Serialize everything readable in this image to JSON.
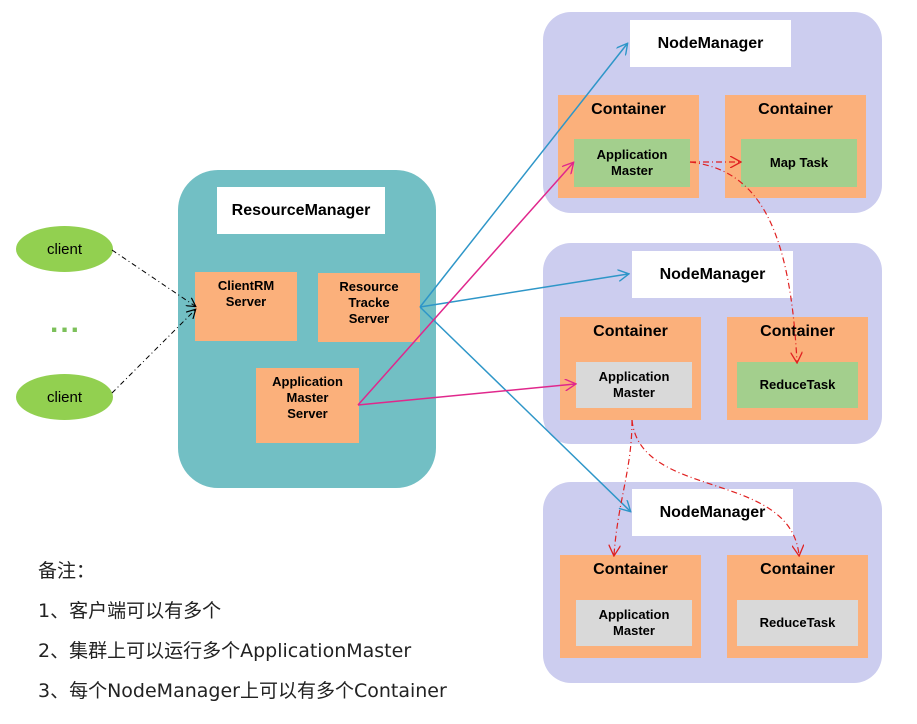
{
  "resource_manager": {
    "title": "ResourceManager",
    "client_rm_server": "ClientRM\nServer",
    "resource_tracker_server": "Resource\nTracke\nServer",
    "app_master_server": "Application\nMaster\nServer"
  },
  "clients": [
    {
      "label": "client"
    },
    {
      "label": "client"
    }
  ],
  "ellipsis": "...",
  "node_managers": [
    {
      "title": "NodeManager",
      "containers": [
        {
          "label": "Container",
          "inner": "Application\nMaster"
        },
        {
          "label": "Container",
          "inner": "Map Task"
        }
      ]
    },
    {
      "title": "NodeManager",
      "containers": [
        {
          "label": "Container",
          "inner": "Application\nMaster"
        },
        {
          "label": "Container",
          "inner": "ReduceTask"
        }
      ]
    },
    {
      "title": "NodeManager",
      "containers": [
        {
          "label": "Container",
          "inner": "Application\nMaster"
        },
        {
          "label": "Container",
          "inner": "ReduceTask"
        }
      ]
    }
  ],
  "notes": {
    "heading": "备注：",
    "items": [
      "1、客户端可以有多个",
      "2、集群上可以运行多个ApplicationMaster",
      "3、每个NodeManager上可以有多个Container"
    ]
  },
  "colors": {
    "node_group": "#cccdef",
    "resource_manager": "#72bfc4",
    "container": "#fbb07b",
    "task_green": "#a3cf8d",
    "task_gray": "#d9d9d9",
    "client": "#92d050",
    "arrow_blue": "#2e96c8",
    "arrow_magenta": "#e0278c",
    "arrow_red": "#e02020"
  }
}
